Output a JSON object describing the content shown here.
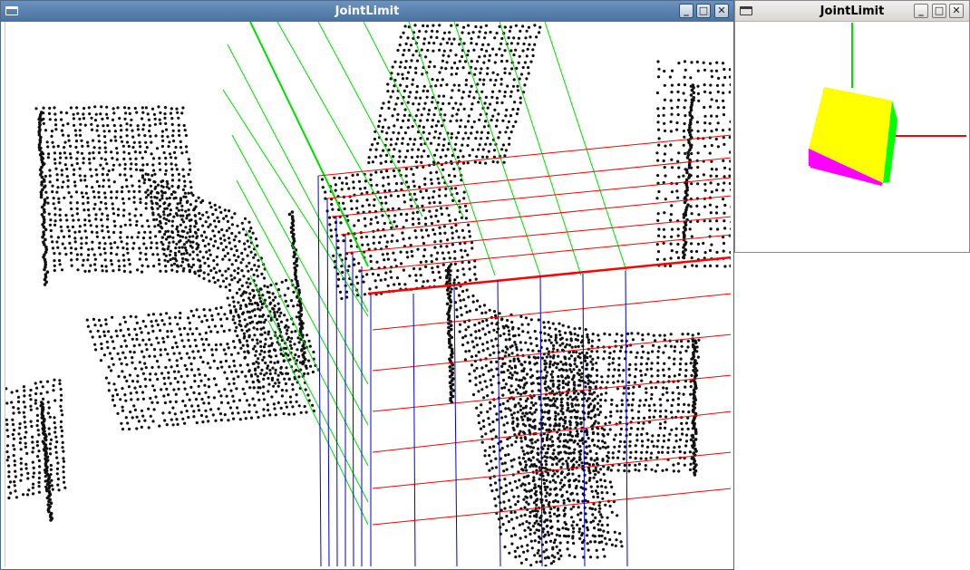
{
  "main_window": {
    "title": "JointLimit",
    "buttons": {
      "minimize": "_",
      "maximize": "□",
      "close": "✕"
    },
    "icon": "window-menu-icon",
    "view": "point-cloud-with-axis-grid"
  },
  "side_window": {
    "title": "JointLimit",
    "buttons": {
      "minimize": "_",
      "maximize": "□",
      "close": "✕"
    },
    "icon": "window-menu-icon",
    "view": "orientation-cube-with-axes"
  },
  "colors": {
    "titlebar_active": "#48729f",
    "titlebar_inactive": "#dad7d2",
    "point_cloud": "#111111",
    "axis_x": "#ff0000",
    "axis_y": "#00dd00",
    "axis_z": "#0000cc",
    "cube_top": "#ffff00",
    "cube_side": "#00ff00",
    "cube_bottom": "#ff00ff"
  }
}
